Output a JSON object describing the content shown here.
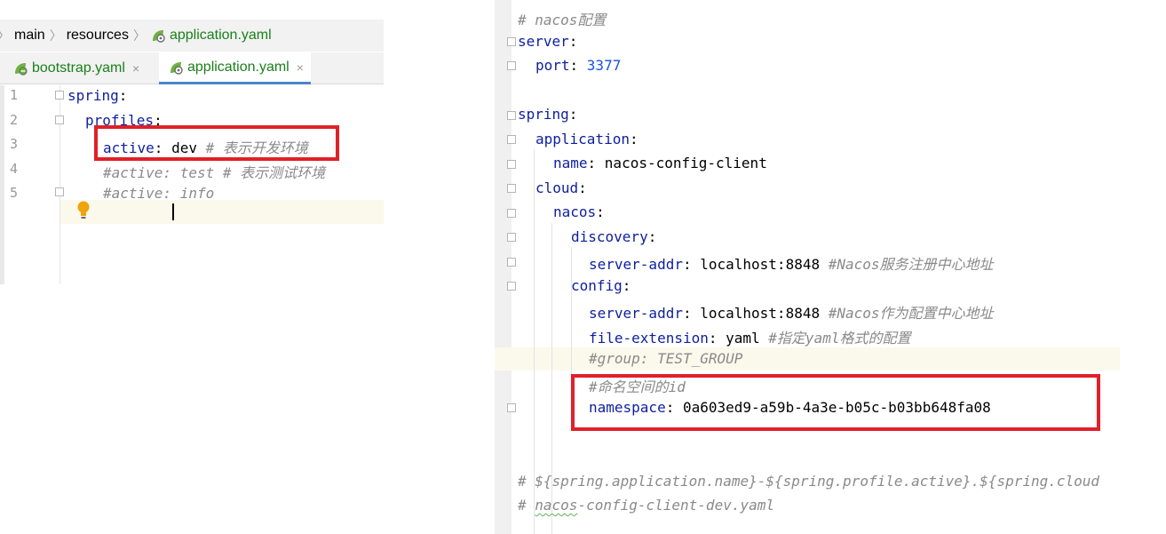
{
  "breadcrumb": {
    "items": [
      "main",
      "resources",
      "application.yaml"
    ],
    "separator": "〉"
  },
  "tabs": [
    {
      "label": "bootstrap.yaml",
      "close": "×"
    },
    {
      "label": "application.yaml",
      "close": "×",
      "active": true
    }
  ],
  "left_editor": {
    "line_numbers": [
      "1",
      "2",
      "3",
      "4",
      "5"
    ],
    "lines": {
      "l1_key": "spring",
      "l1_colon": ":",
      "l2_key": "profiles",
      "l2_colon": ":",
      "l3_key": "active",
      "l3_colon": ":",
      "l3_value": " dev ",
      "l3_comment": "# 表示开发环境",
      "l4_comment": "#active: test # 表示测试环境",
      "l5_comment_a": "#active:",
      "l5_comment_b": " info"
    }
  },
  "right_editor": {
    "lines": {
      "r1_comment": "# nacos配置",
      "r2_key": "server",
      "r2_colon": ":",
      "r3_key": "port",
      "r3_colon": ": ",
      "r3_value": "3377",
      "r5_key": "spring",
      "r5_colon": ":",
      "r6_key": "application",
      "r6_colon": ":",
      "r7_key": "name",
      "r7_colon": ": ",
      "r7_value": "nacos-config-client",
      "r8_key": "cloud",
      "r8_colon": ":",
      "r9_key": "nacos",
      "r9_colon": ":",
      "r10_key": "discovery",
      "r10_colon": ":",
      "r11_key": "server-addr",
      "r11_colon": ": ",
      "r11_value": "localhost:8848 ",
      "r11_comment": "#Nacos服务注册中心地址",
      "r12_key": "config",
      "r12_colon": ":",
      "r13_key": "server-addr",
      "r13_colon": ": ",
      "r13_value": "localhost:8848 ",
      "r13_comment": "#Nacos作为配置中心地址",
      "r14_key": "file-extension",
      "r14_colon": ": ",
      "r14_value": "yaml ",
      "r14_comment": "#指定yaml格式的配置",
      "r15_comment": "#group: TEST_GROUP",
      "r16_comment": "#命名空间的id",
      "r17_key": "namespace",
      "r17_colon": ": ",
      "r17_value": "0a603ed9-a59b-4a3e-b05c-b03bb648fa08",
      "r20_comment": "# ${spring.application.name}-${spring.profile.active}.${spring.cloud",
      "r21_comment_a": "# ",
      "r21_comment_b": "nacos",
      "r21_comment_c": "-config-client-dev.yaml"
    }
  },
  "colors": {
    "highlight_box": "#e0202a",
    "key": "#0d1f9e",
    "number": "#1750eb",
    "comment": "#8a8a8a",
    "file_label": "#1a7f1a"
  }
}
